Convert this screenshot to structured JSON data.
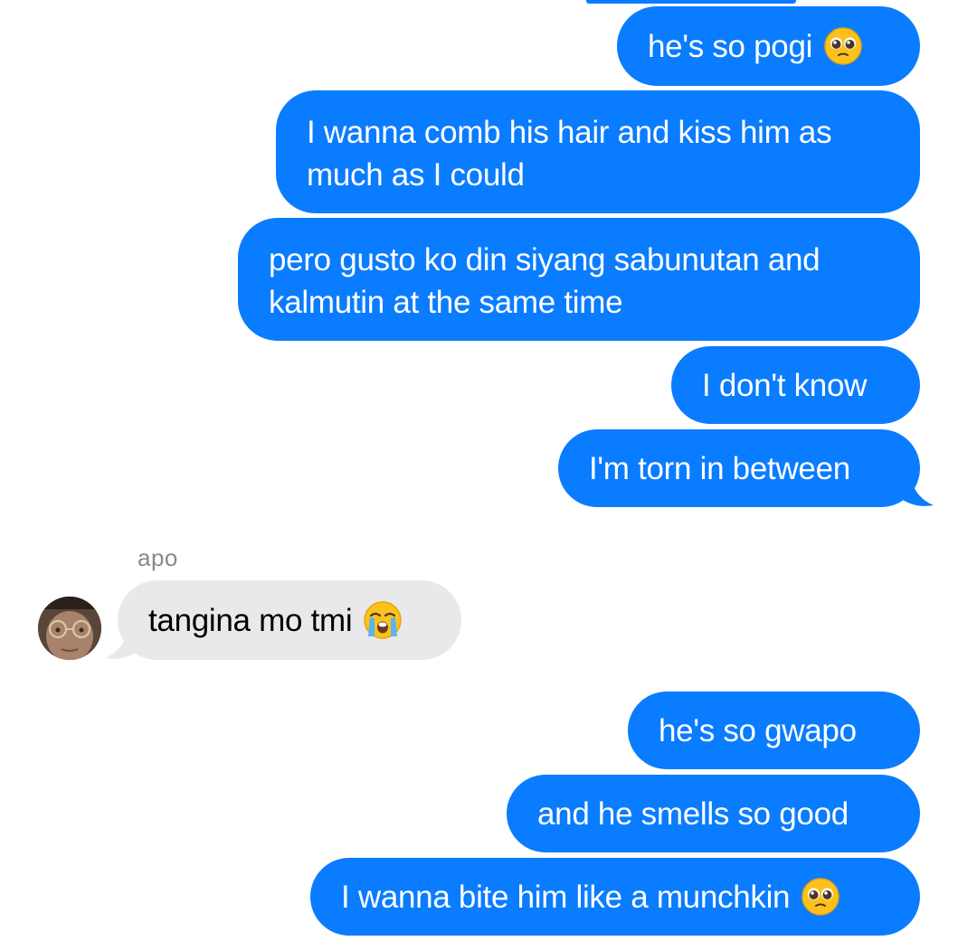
{
  "conversation": {
    "contact_name": "apo",
    "messages": [
      {
        "direction": "sent",
        "text": "he's so pogi",
        "emoji": "pleading-face-emoji"
      },
      {
        "direction": "sent",
        "lines": [
          "I wanna comb his hair and kiss him as",
          "much as I could"
        ]
      },
      {
        "direction": "sent",
        "lines": [
          "pero gusto ko din siyang sabunutan and",
          "kalmutin at the same time"
        ]
      },
      {
        "direction": "sent",
        "text": "I don't know"
      },
      {
        "direction": "sent",
        "text": "I'm torn in between"
      },
      {
        "direction": "received",
        "text": "tangina mo tmi",
        "emoji": "loudly-crying-face-emoji"
      },
      {
        "direction": "sent",
        "text": "he's so gwapo"
      },
      {
        "direction": "sent",
        "text": "and he smells so good"
      },
      {
        "direction": "sent",
        "text": "I wanna bite him like a munchkin",
        "emoji": "pleading-face-emoji"
      }
    ]
  },
  "colors": {
    "sent_bubble": "#0a7cff",
    "received_bubble": "#e9e9eb",
    "sender_name": "#8a8a8e",
    "background": "#ffffff"
  }
}
